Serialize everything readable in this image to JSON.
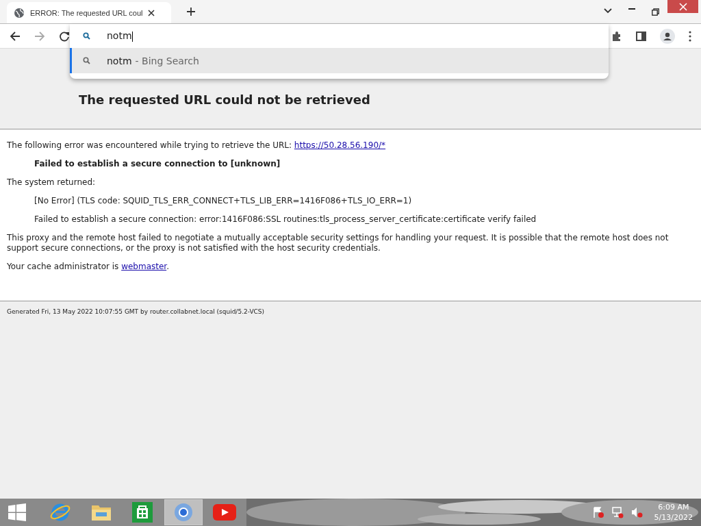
{
  "tab": {
    "title": "ERROR: The requested URL coul",
    "selected": true
  },
  "omnibox": {
    "value": "notm",
    "suggestions": [
      {
        "query": "notm",
        "source": "- Bing Search",
        "selected": true
      }
    ]
  },
  "page": {
    "subheading": "The requested URL could not be retrieved",
    "intro": "The following error was encountered while trying to retrieve the URL:",
    "url": "https://50.28.56.190/*",
    "error": "Failed to establish a secure connection to [unknown]",
    "returned_label": "The system returned:",
    "details": [
      "[No Error] (TLS code: SQUID_TLS_ERR_CONNECT+TLS_LIB_ERR=1416F086+TLS_IO_ERR=1)",
      "Failed to establish a secure connection: error:1416F086:SSL routines:tls_process_server_certificate:certificate verify failed"
    ],
    "explanation": "This proxy and the remote host failed to negotiate a mutually acceptable security settings for handling your request. It is possible that the remote host does not support secure connections, or the proxy is not satisfied with the host security credentials.",
    "admin_text": "Your cache administrator is",
    "admin_link": "webmaster",
    "admin_tail": ".",
    "footer": "Generated Fri, 13 May 2022 10:07:55 GMT by router.collabnet.local (squid/5.2-VCS)"
  },
  "taskbar": {
    "apps": [
      {
        "kind": "ie",
        "selected": false
      },
      {
        "kind": "explorer",
        "selected": false
      },
      {
        "kind": "store",
        "selected": false
      },
      {
        "kind": "chrome",
        "selected": true
      },
      {
        "kind": "youtube",
        "selected": false
      }
    ],
    "time": "6:09 AM",
    "date": "5/13/2022"
  }
}
